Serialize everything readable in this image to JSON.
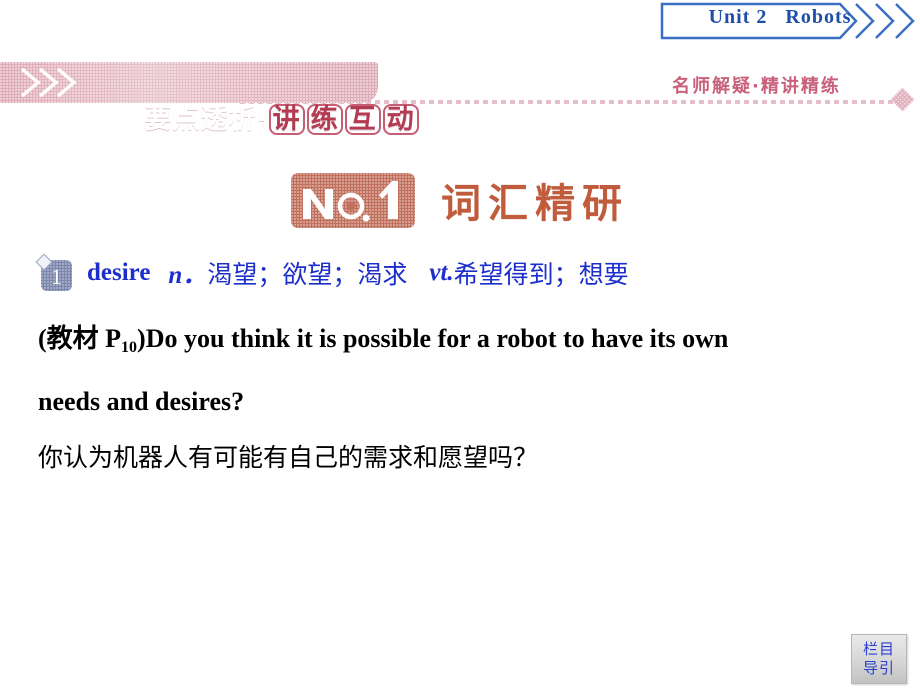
{
  "slide": {
    "background_color": "#ffffff"
  },
  "unit_header": {
    "label": "Unit 2   Robots",
    "text_color": "#1e4fa8",
    "arrow_icon": "double-chevron-right-icon"
  },
  "section_banner": {
    "title_plain": "要点透析",
    "title_separator": "·",
    "title_circled": [
      "讲",
      "练",
      "互",
      "动"
    ],
    "subtitle": "名师解疑·精讲精练",
    "banner_color": "#e2b9c2",
    "subtitle_color": "#c9617c",
    "chevron_icon": "double-chevron-right-icon",
    "diamond_icon": "diamond-marker-icon"
  },
  "no1_heading": {
    "badge_label": "NO.1",
    "badge_color": "#c0705c",
    "title": "词汇精研",
    "title_color": "#c05c3c"
  },
  "entry": {
    "number": "1",
    "badge_color": "#7d87ad",
    "word": "desire",
    "pos_noun": "n．",
    "definition_noun": "渴望；欲望；渴求",
    "pos_verb": "vt.",
    "definition_verb": "希望得到；想要",
    "text_color": "#1c2ecb"
  },
  "example": {
    "source_prefix": "(教材 P",
    "source_page": "10",
    "source_suffix": ")",
    "english_line_1": "Do you think it is possible for a robot to have its own",
    "english_line_2": "needs and desires?",
    "chinese_line": "你认为机器人有可能有自己的需求和愿望吗？"
  },
  "nav_button": {
    "line1": "栏目",
    "line2": "导引",
    "text_color": "#2b3fd0"
  }
}
